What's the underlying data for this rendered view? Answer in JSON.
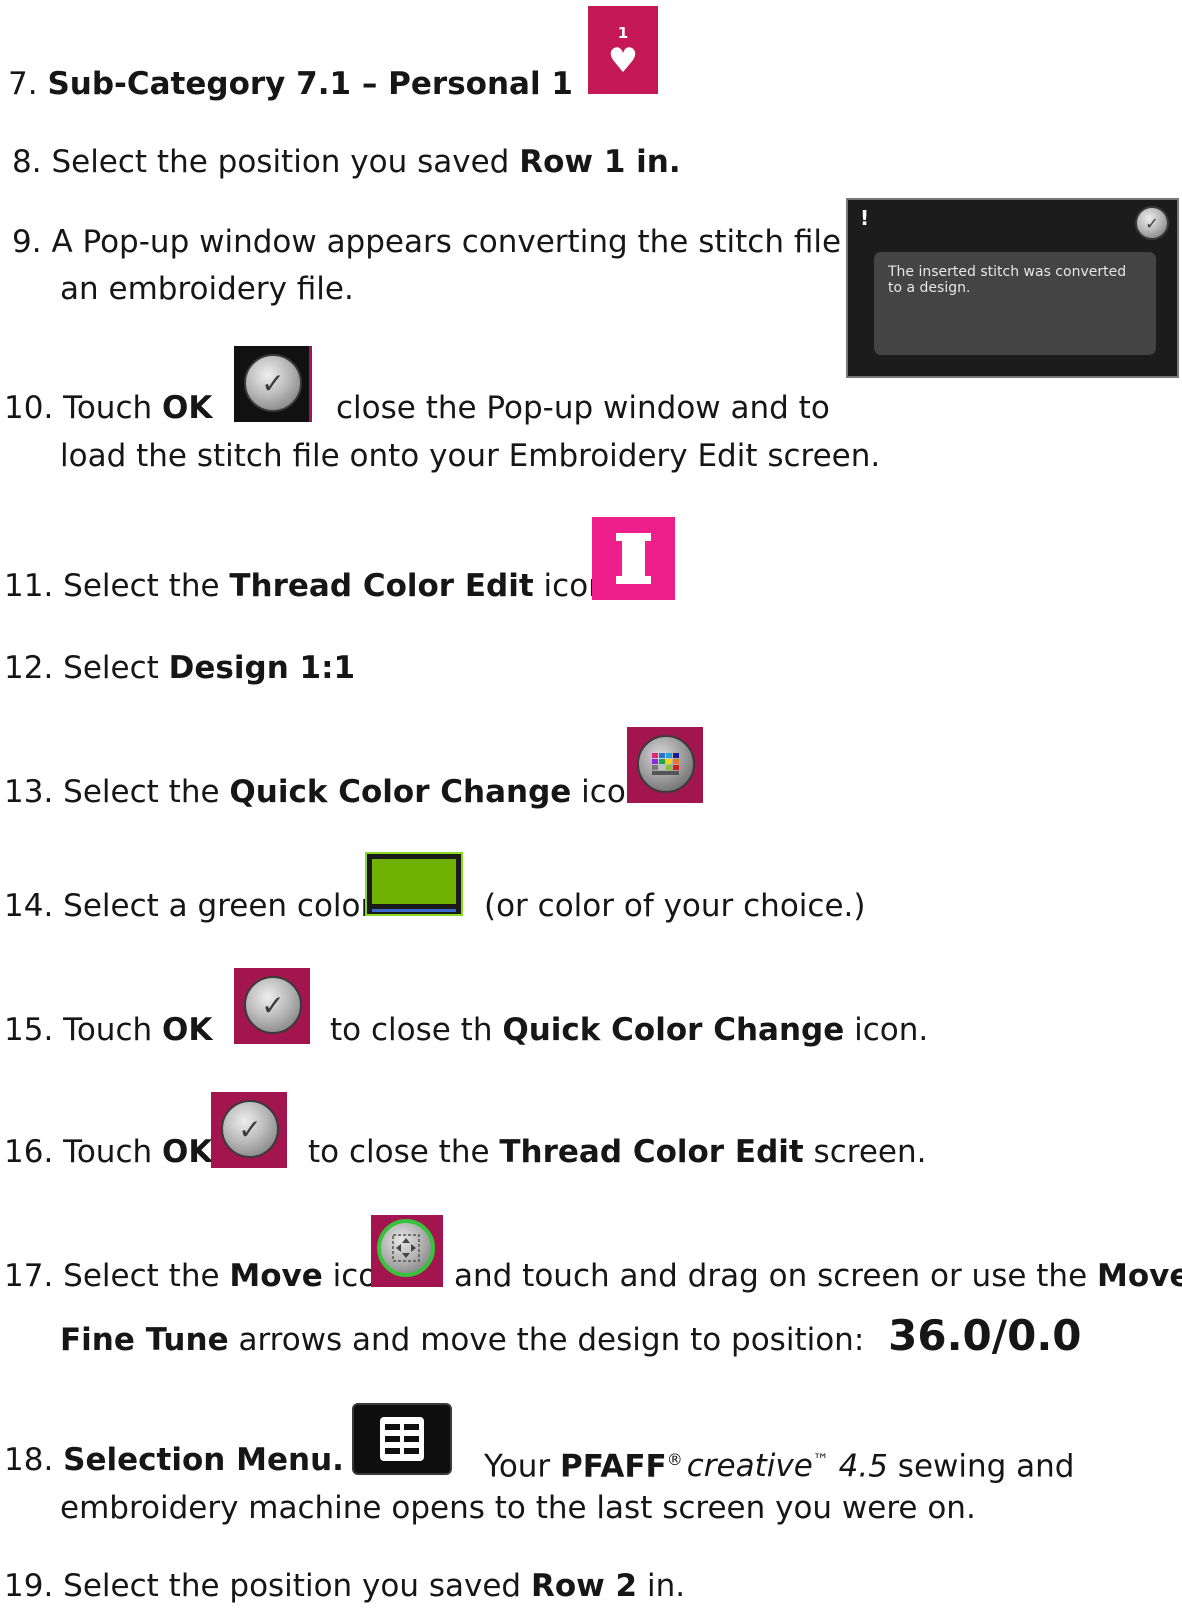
{
  "steps": {
    "s7": {
      "num": "7.",
      "b1": "Sub-Category 7.1 – Personal 1",
      "icon_label": "1"
    },
    "s8": {
      "num": "8.",
      "t1": "Select the position you saved ",
      "b1": "Row 1 in."
    },
    "s9": {
      "num": "9.",
      "t1": "A Pop-up window appears converting the stitch file to",
      "t2": "an embroidery file."
    },
    "s10": {
      "num": "10.",
      "t1": "Touch ",
      "b1": "OK",
      "t2": "close the Pop-up window and to",
      "t3": "load the stitch file onto your Embroidery Edit screen."
    },
    "s11": {
      "num": "11.",
      "t1": "Select the ",
      "b1": "Thread Color Edit",
      "t2": " icon."
    },
    "s12": {
      "num": "12.",
      "t1": "Select ",
      "b1": "Design 1:1"
    },
    "s13": {
      "num": "13.",
      "t1": "Select the ",
      "b1": "Quick Color Change",
      "t2": " icon."
    },
    "s14": {
      "num": "14.",
      "t1": "Select a green color",
      "t2": "(or color of your choice.)"
    },
    "s15": {
      "num": "15.",
      "t1": "Touch ",
      "b1": "OK",
      "t2": "to close th ",
      "b2": "Quick Color Change",
      "t3": " icon."
    },
    "s16": {
      "num": "16.",
      "t1": "Touch ",
      "b1": "OK",
      "t2": "to close the ",
      "b2": "Thread Color Edit",
      "t3": " screen."
    },
    "s17": {
      "num": "17.",
      "t1": "Select the ",
      "b1": "Move",
      "t2": " icon",
      "t3": "and touch and drag on screen or use the ",
      "b2": "Move –",
      "b3": "Fine Tune",
      "t4": " arrows and move the design to position:",
      "big": "36.0/0.0"
    },
    "s18": {
      "num": "18.",
      "b1": "Selection Menu.",
      "t1": "Your ",
      "b2": "PFAFF",
      "reg": "®",
      "i1": "creative",
      "tm": "™",
      "i2": " 4.5",
      "t2": " sewing and",
      "t3": "embroidery machine opens to the last screen you were on."
    },
    "s19": {
      "num": "19.",
      "t1": "Select the position you saved ",
      "b1": "Row 2",
      "t2": " in."
    }
  },
  "popup": {
    "exclaim": "!",
    "message": "The inserted stitch was converted to a design.",
    "ok_symbol": "✓"
  },
  "icons": {
    "ok_symbol": "✓",
    "heart": "♥"
  },
  "colors": {
    "crimson": "#a3154f",
    "pink": "#ee1e8a",
    "green": "#6fb100",
    "popup_bg": "#1c1c1c"
  }
}
